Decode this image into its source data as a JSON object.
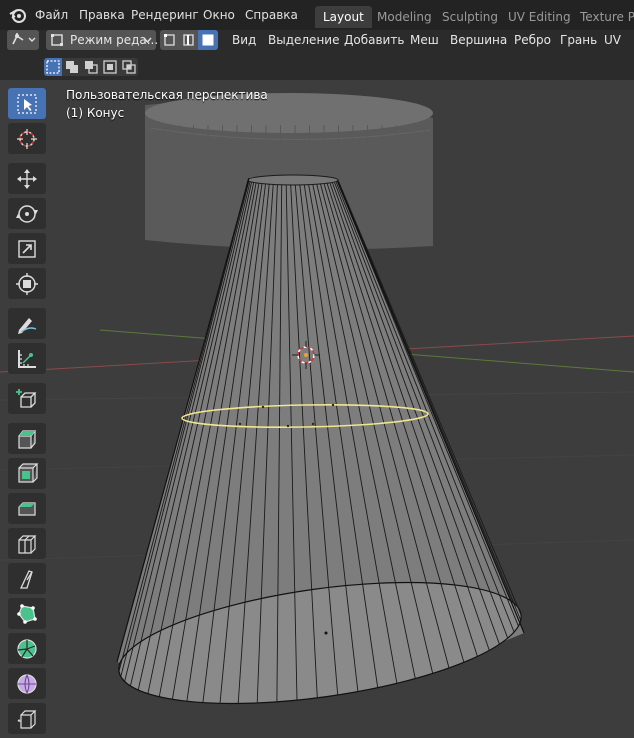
{
  "topbar": {
    "menus": [
      "Файл",
      "Правка",
      "Рендеринг",
      "Окно",
      "Справка"
    ],
    "workspace_tabs": [
      "Layout",
      "Modeling",
      "Sculpting",
      "UV Editing",
      "Texture Pa"
    ],
    "active_tab": "Layout"
  },
  "header": {
    "mode_label": "Режим реда...",
    "menus": [
      "Вид",
      "Выделение",
      "Добавить",
      "Меш",
      "Вершина",
      "Ребро",
      "Грань",
      "UV"
    ]
  },
  "viewport": {
    "perspective_label": "Пользовательская перспектива",
    "object_label": "(1) Конус"
  },
  "toolbar": {
    "tools": [
      "select-box",
      "cursor",
      "move",
      "rotate",
      "scale",
      "transform",
      "annotate",
      "measure",
      "add-cube",
      "extrude-region",
      "inset-faces",
      "bevel",
      "loop-cut",
      "knife",
      "poly-build",
      "spin",
      "smooth",
      "shrink-fatten"
    ],
    "active_tool": "select-box"
  },
  "colors": {
    "accent": "#4772b3",
    "selected_edge_loop": "#f0e68c",
    "background": "#3d3d3d"
  }
}
